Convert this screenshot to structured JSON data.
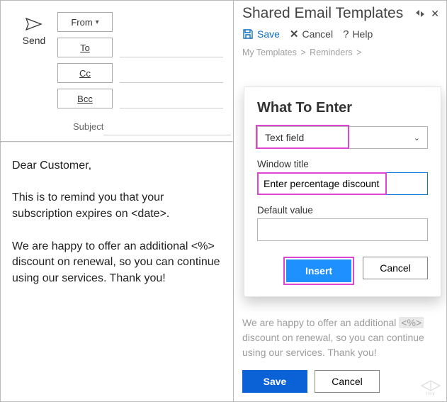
{
  "email": {
    "send_label": "Send",
    "from_label": "From",
    "to_label": "To",
    "cc_label": "Cc",
    "bcc_label": "Bcc",
    "subject_label": "Subject",
    "subject_value": "",
    "body": "Dear Customer,\n\nThis is to remind you that your subscription expires on <date>.\n\nWe are happy to offer an additional <%> discount on renewal, so you can continue using our services. Thank you!"
  },
  "panel": {
    "title": "Shared Email Templates",
    "actions": {
      "save": "Save",
      "cancel": "Cancel",
      "help": "Help"
    },
    "breadcrumb": [
      "My Templates",
      "Reminders"
    ],
    "preview_line1": "We are happy to offer an additional",
    "preview_token": "<%>",
    "preview_line2": "discount on renewal, so you can continue using our services. Thank you!",
    "save_btn": "Save",
    "cancel_btn": "Cancel"
  },
  "wte": {
    "title": "What To Enter",
    "type_value": "Text field",
    "window_title_label": "Window title",
    "window_title_value": "Enter percentage discount",
    "default_label": "Default value",
    "default_value": "",
    "insert_btn": "Insert",
    "cancel_btn": "Cancel"
  },
  "colors": {
    "primary": "#0b62d6",
    "accent_blue": "#1e90ff",
    "highlight_pink": "#e044d3"
  }
}
